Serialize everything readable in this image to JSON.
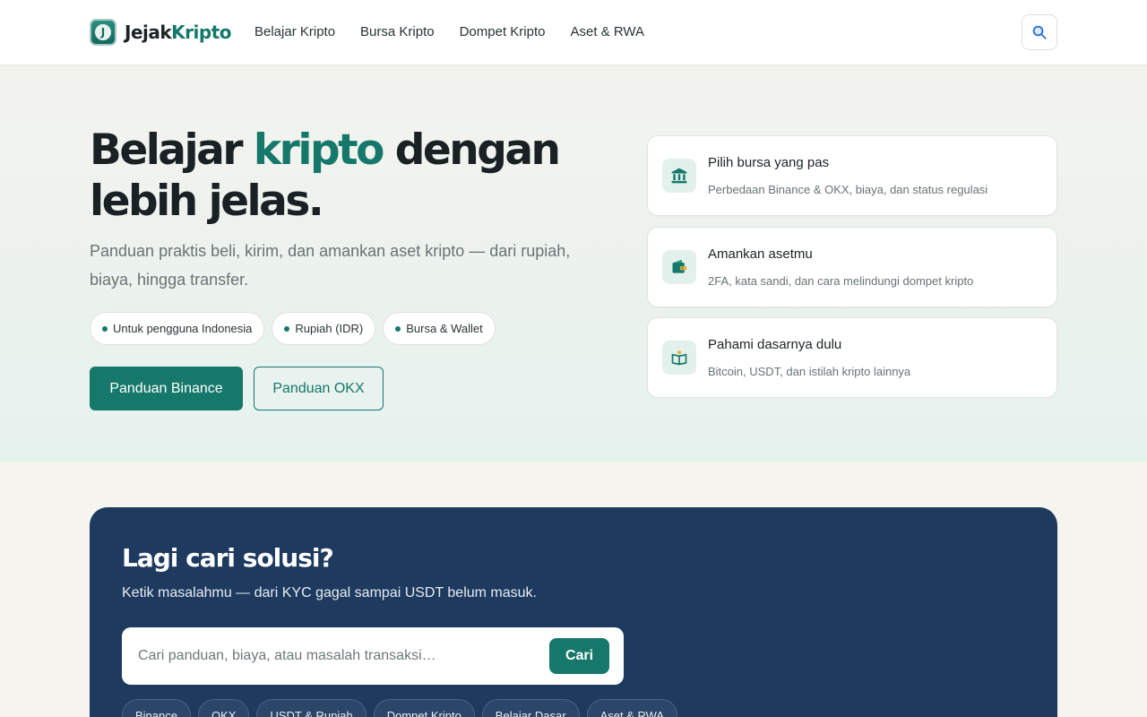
{
  "header": {
    "logo_part1": "Jejak",
    "logo_part2": "Kripto",
    "logo_mark": "J",
    "nav": [
      "Belajar Kripto",
      "Bursa Kripto",
      "Dompet Kripto",
      "Aset & RWA"
    ],
    "search_icon": "search-icon"
  },
  "hero": {
    "title_part1": "Belajar ",
    "title_accent": "kripto",
    "title_part2": " dengan lebih jelas.",
    "subtitle": "Panduan praktis beli, kirim, dan amankan aset kripto — dari rupiah, biaya, hingga transfer.",
    "pills": [
      "Untuk pengguna Indonesia",
      "Rupiah (IDR)",
      "Bursa & Wallet"
    ],
    "primary_button": "Panduan Binance",
    "secondary_button": "Panduan OKX"
  },
  "cards": [
    {
      "icon": "bank-icon",
      "title": "Pilih bursa yang pas",
      "desc": "Perbedaan Binance & OKX, biaya, dan status regulasi"
    },
    {
      "icon": "wallet-icon",
      "title": "Amankan asetmu",
      "desc": "2FA, kata sandi, dan cara melindungi dompet kripto"
    },
    {
      "icon": "book-icon",
      "title": "Pahami dasarnya dulu",
      "desc": "Bitcoin, USDT, dan istilah kripto lainnya"
    }
  ],
  "search_section": {
    "title": "Lagi cari solusi?",
    "subtitle": "Ketik masalahmu — dari KYC gagal sampai USDT belum masuk.",
    "placeholder": "Cari panduan, biaya, atau masalah transaksi…",
    "button": "Cari",
    "tags": [
      "Binance",
      "OKX",
      "USDT & Rupiah",
      "Dompet Kripto",
      "Belajar Dasar",
      "Aset & RWA"
    ]
  },
  "colors": {
    "accent": "#15786a",
    "panel": "#1e3a5f"
  }
}
